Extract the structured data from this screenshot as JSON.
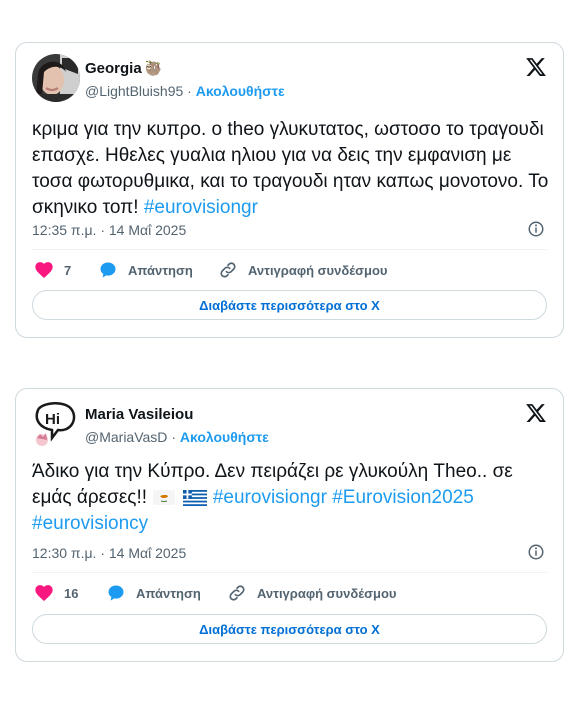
{
  "tweets": [
    {
      "author_name": "Georgia",
      "author_emoji": "🦥",
      "handle": "@LightBluish95",
      "separator": "·",
      "follow_label": "Ακολουθήστε",
      "text": "κριμα για την κυπρο. ο theo γλυκυτατος, ωστοσο το τραγουδι επασχε. Ηθελες γυαλια ηλιου για να δεις την εμφανιση με τοσα φωτορυθμικα, και το τραγουδι ηταν καπως μονοτονο. Το σκηνικο τοπ! ",
      "hashtags": [
        "#eurovisiongr"
      ],
      "timestamp": "12:35 π.μ. · 14 Μαΐ 2025",
      "likes": "7",
      "reply_label": "Απάντηση",
      "copy_label": "Αντιγραφή συνδέσμου",
      "read_more_label": "Διαβάστε περισσότερα στο X"
    },
    {
      "author_name": "Maria Vasileiou",
      "handle": "@MariaVasD",
      "separator": "·",
      "follow_label": "Ακολουθήστε",
      "avatar_text": "Hi",
      "text": "Άδικο για την Κύπρο. Δεν πειράζει ρε γλυκούλη Theo.. σε εμάς άρεσες!!",
      "hashtags": [
        "#eurovisiongr",
        "#Eurovision2025",
        "#eurovisioncy"
      ],
      "timestamp": "12:30 π.μ. · 14 Μαΐ 2025",
      "likes": "16",
      "reply_label": "Απάντηση",
      "copy_label": "Αντιγραφή συνδέσμου",
      "read_more_label": "Διαβάστε περισσότερα στο X"
    }
  ],
  "colors": {
    "link": "#1d9bf0",
    "like": "#f91880",
    "muted": "#536471",
    "border": "#cfd9de"
  }
}
